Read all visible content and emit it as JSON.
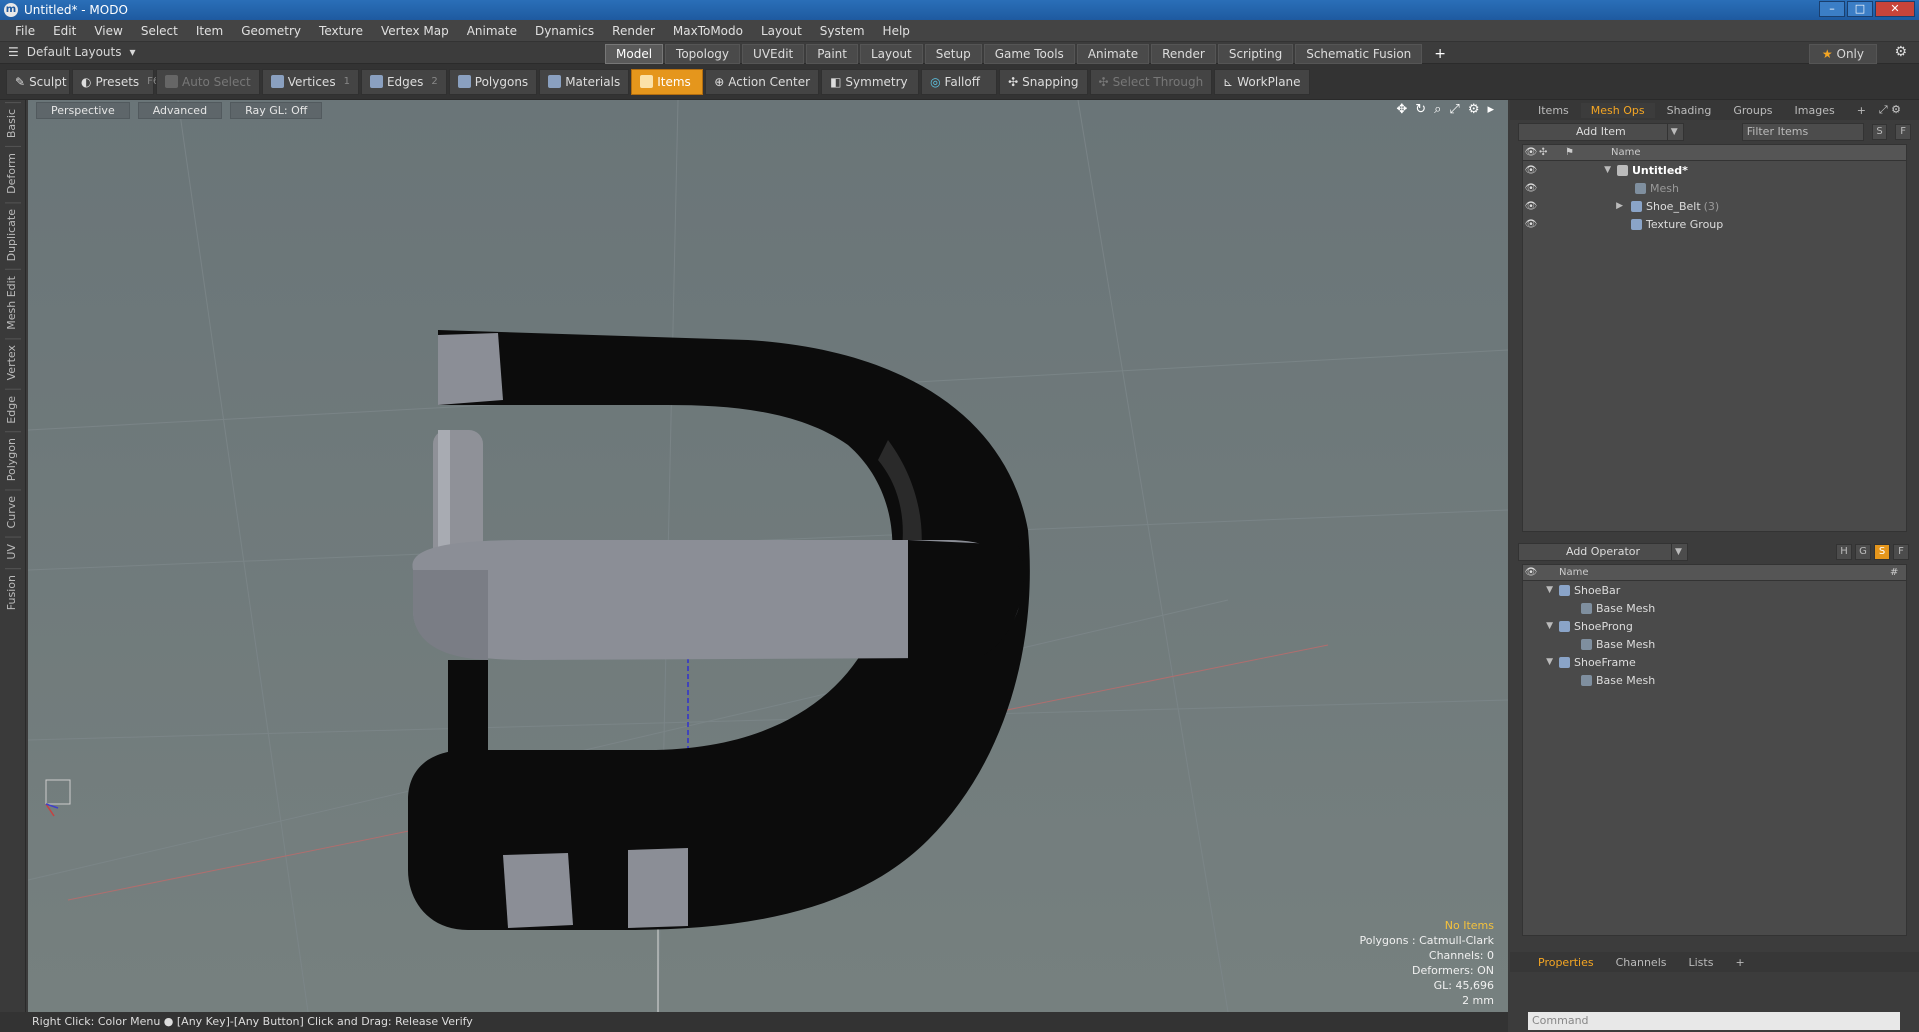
{
  "window": {
    "title": "Untitled* - MODO",
    "app_icon": "modo-icon"
  },
  "menu": [
    "File",
    "Edit",
    "View",
    "Select",
    "Item",
    "Geometry",
    "Texture",
    "Vertex Map",
    "Animate",
    "Dynamics",
    "Render",
    "MaxToModo",
    "Layout",
    "System",
    "Help"
  ],
  "layoutbar": {
    "layout_label": "Default Layouts",
    "tabs": [
      "Model",
      "Topology",
      "UVEdit",
      "Paint",
      "Layout",
      "Setup",
      "Game Tools",
      "Animate",
      "Render",
      "Scripting",
      "Schematic Fusion"
    ],
    "active_tab": "Model",
    "plus": "+",
    "only_label": "Only"
  },
  "toolbar": {
    "sculpt": "Sculpt",
    "presets": "Presets",
    "presets_key": "F6",
    "auto_select": "Auto Select",
    "vertices": "Vertices",
    "vertices_count": "1",
    "edges": "Edges",
    "edges_count": "2",
    "polygons": "Polygons",
    "materials": "Materials",
    "items": "Items",
    "action_center": "Action Center",
    "symmetry": "Symmetry",
    "falloff": "Falloff",
    "snapping": "Snapping",
    "select_through": "Select Through",
    "workplane": "WorkPlane"
  },
  "left_tabs": [
    "Basic",
    "Deform",
    "Duplicate",
    "Mesh Edit",
    "Vertex",
    "Edge",
    "Polygon",
    "Curve",
    "UV",
    "Fusion"
  ],
  "viewport": {
    "view_label": "Perspective",
    "shading_label": "Advanced",
    "raygl_label": "Ray GL: Off",
    "stats": {
      "selection": "No Items",
      "polygons": "Polygons : Catmull-Clark",
      "channels": "Channels: 0",
      "deformers": "Deformers: ON",
      "gl": "GL: 45,696",
      "scale": "2 mm"
    }
  },
  "statusbar": "Right Click: Color Menu ● [Any Key]-[Any Button] Click and Drag: Release Verify",
  "right_panel": {
    "tabs": [
      "Items",
      "Mesh Ops",
      "Shading",
      "Groups",
      "Images"
    ],
    "active_tab": "Mesh Ops",
    "add_item": "Add Item",
    "filter_items": "Filter Items",
    "s_label": "S",
    "f_label": "F",
    "tree_header": "Name",
    "items": [
      {
        "label": "Untitled*"
      },
      {
        "label": "Mesh"
      },
      {
        "label": "Shoe_Belt",
        "count": "(3)"
      },
      {
        "label": "Texture Group"
      }
    ],
    "add_operator": "Add Operator",
    "op_buttons": [
      "H",
      "G",
      "S",
      "F"
    ],
    "ops_header": "Name",
    "ops_hash": "#",
    "operators": [
      {
        "name": "ShoeBar",
        "child": "Base Mesh"
      },
      {
        "name": "ShoeProng",
        "child": "Base Mesh"
      },
      {
        "name": "ShoeFrame",
        "child": "Base Mesh"
      }
    ],
    "bottom_tabs": [
      "Properties",
      "Channels",
      "Lists"
    ],
    "bottom_active": "Properties",
    "command_placeholder": "Command"
  }
}
